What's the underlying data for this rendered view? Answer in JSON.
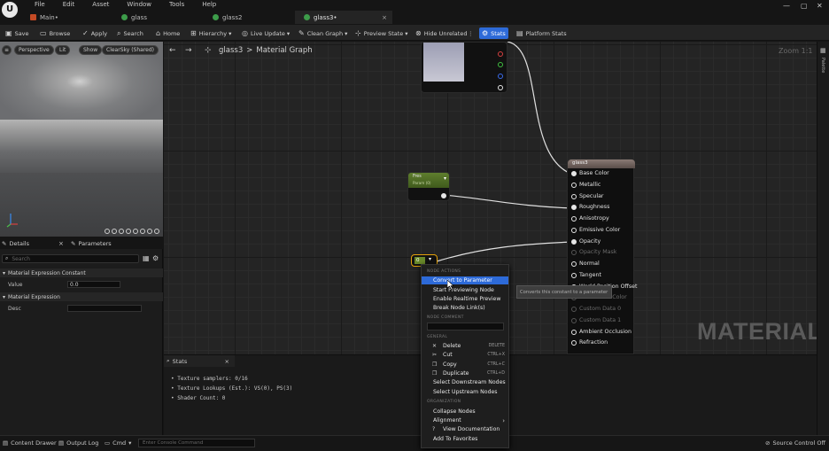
{
  "menubar": {
    "logo": "U",
    "items": [
      "File",
      "Edit",
      "Asset",
      "Window",
      "Tools",
      "Help"
    ]
  },
  "tabs": [
    {
      "label": "Main•",
      "active": false
    },
    {
      "label": "glass",
      "active": false
    },
    {
      "label": "glass2",
      "active": false
    },
    {
      "label": "glass3•",
      "active": true,
      "close": "×"
    }
  ],
  "toolbar": {
    "items": [
      "Save",
      "Browse",
      "Apply",
      "Search",
      "Home",
      "Hierarchy",
      "Live Update",
      "Clean Graph",
      "Preview State",
      "Hide Unrelated",
      "Stats",
      "Platform Stats"
    ],
    "active_item": "Stats",
    "accent_color": "#2d6ad8"
  },
  "viewport": {
    "buttons": [
      "Perspective",
      "Lit",
      "Show",
      "ClearSky (Shared)"
    ]
  },
  "details": {
    "tabs": [
      "Details",
      "Parameters"
    ],
    "search_placeholder": "Search",
    "section1": "Material Expression Constant",
    "value_label": "Value",
    "value": "0.0",
    "section2": "Material Expression",
    "desc_label": "Desc",
    "desc_value": ""
  },
  "graph": {
    "breadcrumb_asset": "glass3",
    "breadcrumb_separator": ">",
    "breadcrumb_page": "Material Graph",
    "zoom": "Zoom 1:1",
    "watermark": "MATERIAL",
    "side_label": "Palette",
    "material_node": {
      "title": "glass3",
      "inputs": [
        "Base Color",
        "Metallic",
        "Specular",
        "Roughness",
        "Anisotropy",
        "Emissive Color",
        "Opacity",
        "Opacity Mask",
        "Normal",
        "Tangent",
        "World Position Offset",
        "Subsurface Color",
        "Custom Data 0",
        "Custom Data 1",
        "Ambient Occlusion",
        "Refraction"
      ],
      "disabled_inputs": [
        "Opacity Mask",
        "Subsurface Color",
        "Custom Data 0",
        "Custom Data 1"
      ]
    },
    "green_node": {
      "title": "Fres",
      "subtitle": "Param (0)"
    },
    "constant_node": {
      "value": "0"
    },
    "tooltip": "Converts this constant to a parameter"
  },
  "context_menu": {
    "header_node_actions": "NODE ACTIONS",
    "node_actions": [
      "Convert to Parameter",
      "Start Previewing Node",
      "Enable Realtime Preview",
      "Break Node Link(s)"
    ],
    "selected": "Convert to Parameter",
    "header_node_comment": "NODE COMMENT",
    "header_general": "GENERAL",
    "general": [
      {
        "label": "Delete",
        "shortcut": "DELETE"
      },
      {
        "label": "Cut",
        "shortcut": "CTRL+X"
      },
      {
        "label": "Copy",
        "shortcut": "CTRL+C"
      },
      {
        "label": "Duplicate",
        "shortcut": "CTRL+D"
      },
      {
        "label": "Select Downstream Nodes",
        "shortcut": ""
      },
      {
        "label": "Select Upstream Nodes",
        "shortcut": ""
      }
    ],
    "header_organization": "ORGANIZATION",
    "organization": [
      "Collapse Nodes",
      "Alignment",
      "View Documentation",
      "Add To Favorites"
    ],
    "submenu_arrow": "›"
  },
  "stats": {
    "tab": "Stats",
    "lines": [
      "• Texture samplers: 0/16",
      "• Texture Lookups (Est.): VS(0), PS(3)",
      "• Shader Count: 0"
    ]
  },
  "statusbar": {
    "content_drawer": "Content Drawer",
    "output_log": "Output Log",
    "cmd": "Cmd",
    "console_placeholder": "Enter Console Command",
    "source_control": "Source Control Off"
  }
}
